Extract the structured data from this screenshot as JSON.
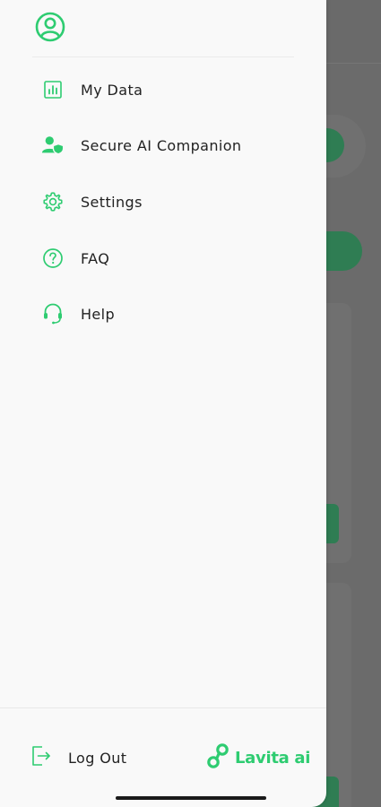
{
  "menu": {
    "items": [
      {
        "label": "My Data",
        "icon": "bar-chart-icon"
      },
      {
        "label": "Secure AI Companion",
        "icon": "user-shield-icon"
      },
      {
        "label": "Settings",
        "icon": "gear-icon"
      },
      {
        "label": "FAQ",
        "icon": "question-circle-icon"
      },
      {
        "label": "Help",
        "icon": "headset-icon"
      }
    ]
  },
  "footer": {
    "logout_label": "Log Out",
    "brand_name": "Lavita ai"
  },
  "colors": {
    "accent": "#2ecc71",
    "text": "#222222",
    "drawer_bg": "#f9f9f9"
  }
}
